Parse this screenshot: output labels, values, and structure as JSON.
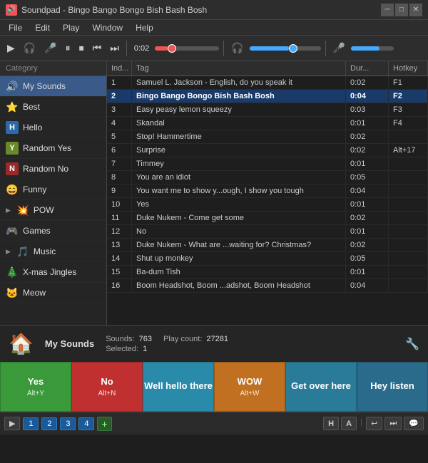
{
  "titleBar": {
    "icon": "🔊",
    "title": "Soundpad - Bingo Bango Bongo Bish Bash Bosh",
    "controls": [
      "─",
      "□",
      "✕"
    ]
  },
  "menuBar": {
    "items": [
      "File",
      "Edit",
      "Play",
      "Window",
      "Help"
    ]
  },
  "toolbar": {
    "timeDisplay": "0:02",
    "buttons": [
      "▶",
      "🎧",
      "🎤",
      "⏸",
      "⏹",
      "⏮",
      "⏭"
    ]
  },
  "tableHeaders": {
    "index": "Ind...",
    "name": "Tag",
    "duration": "Dur...",
    "hotkey": "Hotkey"
  },
  "sidebar": {
    "header": "Category",
    "items": [
      {
        "id": "my-sounds",
        "label": "My Sounds",
        "icon": "🔊",
        "active": true
      },
      {
        "id": "best",
        "label": "Best",
        "icon": "⭐"
      },
      {
        "id": "hello",
        "label": "Hello",
        "icon": "H"
      },
      {
        "id": "random-yes",
        "label": "Random Yes",
        "icon": "Y"
      },
      {
        "id": "random-no",
        "label": "Random No",
        "icon": "N"
      },
      {
        "id": "funny",
        "label": "Funny",
        "icon": "😄"
      },
      {
        "id": "pow",
        "label": "POW",
        "icon": "💥"
      },
      {
        "id": "games",
        "label": "Games",
        "icon": "🎮"
      },
      {
        "id": "music",
        "label": "Music",
        "icon": "🎵"
      },
      {
        "id": "x-mas",
        "label": "X-mas Jingles",
        "icon": "🎄"
      },
      {
        "id": "meow",
        "label": "Meow",
        "icon": "🐱"
      }
    ]
  },
  "sounds": [
    {
      "index": 1,
      "tag": "Samuel L. Jackson - English, do you speak it",
      "duration": "0:02",
      "hotkey": "F1"
    },
    {
      "index": 2,
      "tag": "Bingo Bango Bongo Bish Bash Bosh",
      "duration": "0:04",
      "hotkey": "F2",
      "selected": true
    },
    {
      "index": 3,
      "tag": "Easy peasy lemon squeezy",
      "duration": "0:03",
      "hotkey": "F3"
    },
    {
      "index": 4,
      "tag": "Skandal",
      "duration": "0:01",
      "hotkey": "F4"
    },
    {
      "index": 5,
      "tag": "Stop! Hammertime",
      "duration": "0:02",
      "hotkey": ""
    },
    {
      "index": 6,
      "tag": "Surprise",
      "duration": "0:02",
      "hotkey": "Alt+17"
    },
    {
      "index": 7,
      "tag": "Timmey",
      "duration": "0:01",
      "hotkey": ""
    },
    {
      "index": 8,
      "tag": "You are an idiot",
      "duration": "0:05",
      "hotkey": ""
    },
    {
      "index": 9,
      "tag": "You want me to show y...ough, I show you tough",
      "duration": "0:04",
      "hotkey": ""
    },
    {
      "index": 10,
      "tag": "Yes",
      "duration": "0:01",
      "hotkey": ""
    },
    {
      "index": 11,
      "tag": "Duke Nukem - Come get some",
      "duration": "0:02",
      "hotkey": ""
    },
    {
      "index": 12,
      "tag": "No",
      "duration": "0:01",
      "hotkey": ""
    },
    {
      "index": 13,
      "tag": "Duke Nukem - What are ...waiting for? Christmas?",
      "duration": "0:02",
      "hotkey": ""
    },
    {
      "index": 14,
      "tag": "Shut up monkey",
      "duration": "0:05",
      "hotkey": ""
    },
    {
      "index": 15,
      "tag": "Ba-dum Tish",
      "duration": "0:01",
      "hotkey": ""
    },
    {
      "index": 16,
      "tag": "Boom Headshot, Boom ...adshot, Boom Headshot",
      "duration": "0:04",
      "hotkey": ""
    }
  ],
  "statusBar": {
    "category": "My Sounds",
    "soundsLabel": "Sounds:",
    "soundsCount": "763",
    "playCountLabel": "Play count:",
    "playCount": "27281",
    "selectedLabel": "Selected:",
    "selectedCount": "1"
  },
  "quickButtons": [
    {
      "id": "yes-btn",
      "label": "Yes",
      "hotkey": "Alt+Y",
      "color": "green"
    },
    {
      "id": "no-btn",
      "label": "No",
      "hotkey": "Alt+N",
      "color": "red"
    },
    {
      "id": "well-hello-btn",
      "label": "Well hello there",
      "hotkey": "",
      "color": "cyan"
    },
    {
      "id": "wow-btn",
      "label": "WOW",
      "hotkey": "Alt+W",
      "color": "orange"
    },
    {
      "id": "get-over-btn",
      "label": "Get over here",
      "hotkey": "",
      "color": "get-over"
    },
    {
      "id": "hey-listen-btn",
      "label": "Hey listen",
      "hotkey": "",
      "color": "hey-listen"
    }
  ],
  "bottomBar": {
    "tabs": [
      "1",
      "2",
      "3",
      "4"
    ],
    "addLabel": "+",
    "leftIcons": [
      "H",
      "A"
    ],
    "rightIcons": [
      "↩",
      "⏭",
      "💬"
    ]
  }
}
